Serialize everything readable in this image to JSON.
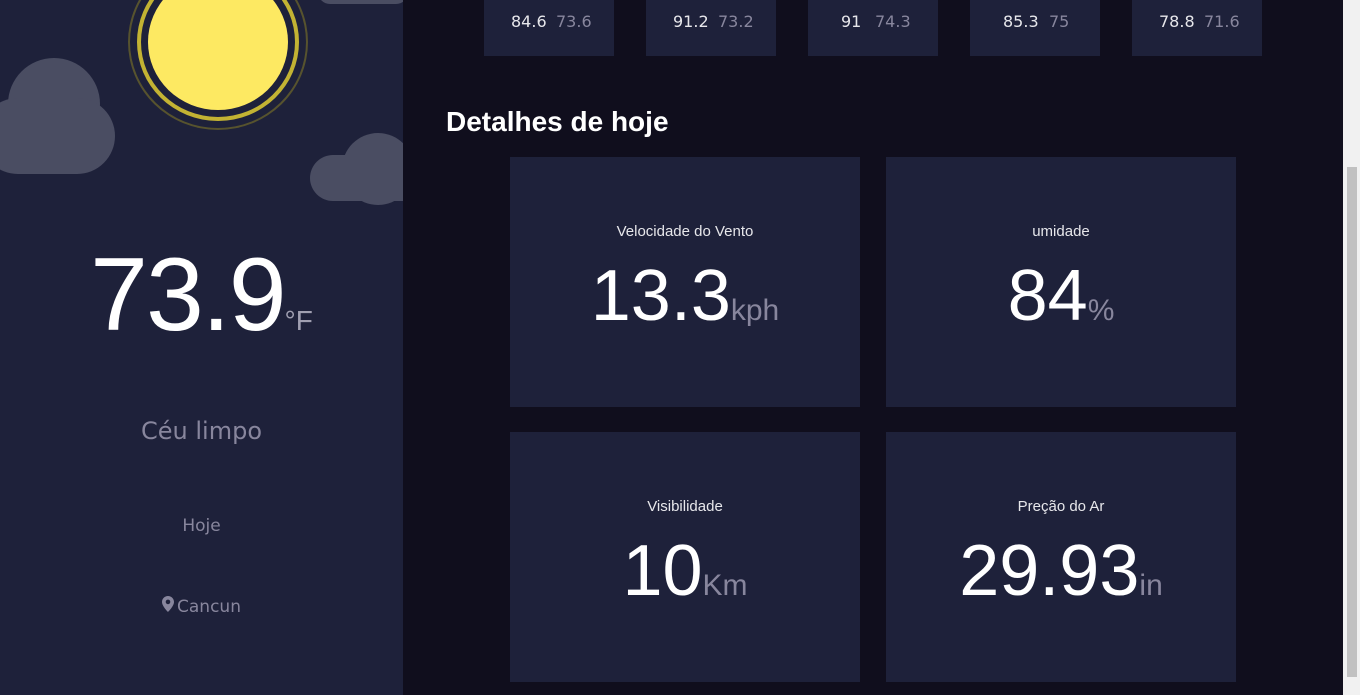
{
  "current": {
    "temperature": "73.9",
    "unit": "°F",
    "description": "Céu limpo",
    "day": "Hoje",
    "location": "Cancun",
    "weather_icon": "sun-icon"
  },
  "forecast": [
    {
      "max": "84.6",
      "min": "73.6"
    },
    {
      "max": "91.2",
      "min": "73.2"
    },
    {
      "max": "91",
      "min": "74.3"
    },
    {
      "max": "85.3",
      "min": "75"
    },
    {
      "max": "78.8",
      "min": "71.6"
    }
  ],
  "details": {
    "title": "Detalhes de hoje",
    "wind": {
      "label": "Velocidade do Vento",
      "value": "13.3",
      "unit": "kph"
    },
    "humidity": {
      "label": "umidade",
      "value": "84",
      "unit": "%"
    },
    "visibility": {
      "label": "Visibilidade",
      "value": "10",
      "unit": "Km"
    },
    "pressure": {
      "label": "Preção do Ar",
      "value": "29.93",
      "unit": "in"
    }
  },
  "colors": {
    "sidebar_bg": "#1e213a",
    "page_bg": "#100e1d",
    "sun": "#fde962",
    "muted_text": "#88869d"
  }
}
